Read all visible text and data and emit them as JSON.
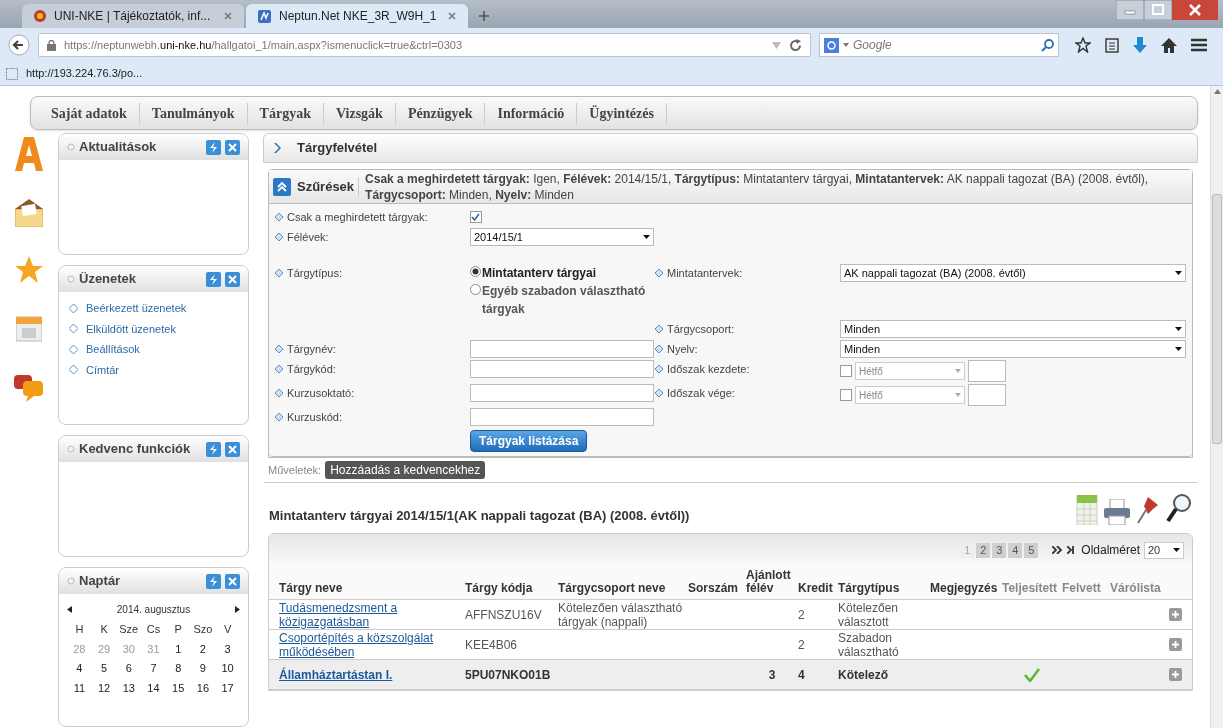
{
  "browser": {
    "tabs": [
      {
        "title": "UNI-NKE | Tájékoztatók, inf...",
        "selected": false
      },
      {
        "title": "Neptun.Net NKE_3R_W9H_1",
        "selected": true
      }
    ],
    "url": "https://neptunwebh.**uni-nke.hu**/hallgatoi_1/main.aspx?ismenuclick=true&ctrl=0303",
    "search_placeholder": "Google",
    "bookmark": "http://193.224.76.3/po..."
  },
  "menu": [
    "Saját adatok",
    "Tanulmányok",
    "Tárgyak",
    "Vizsgák",
    "Pénzügyek",
    "Információ",
    "Ügyintézés"
  ],
  "sidebar": [
    {
      "kind": "empty",
      "title": "Aktualitások"
    },
    {
      "kind": "links",
      "title": "Üzenetek",
      "links": [
        "Beérkezett üzenetek",
        "Elküldött üzenetek",
        "Beállítások",
        "Címtár"
      ]
    },
    {
      "kind": "empty",
      "title": "Kedvenc funkciók"
    },
    {
      "kind": "calendar",
      "title": "Naptár",
      "month": "2014. augusztus",
      "weekdays": [
        "H",
        "K",
        "Sze",
        "Cs",
        "P",
        "Szo",
        "V"
      ],
      "weeks": [
        [
          {
            "d": "28",
            "muted": true
          },
          {
            "d": "29",
            "muted": true
          },
          {
            "d": "30",
            "muted": true
          },
          {
            "d": "31",
            "muted": true
          },
          {
            "d": "1",
            "muted": false
          },
          {
            "d": "2",
            "muted": false
          },
          {
            "d": "3",
            "muted": false
          }
        ],
        [
          {
            "d": "4",
            "muted": false
          },
          {
            "d": "5",
            "muted": false
          },
          {
            "d": "6",
            "muted": false
          },
          {
            "d": "7",
            "muted": false
          },
          {
            "d": "8",
            "muted": false
          },
          {
            "d": "9",
            "muted": false
          },
          {
            "d": "10",
            "muted": false
          }
        ],
        [
          {
            "d": "11",
            "muted": false
          },
          {
            "d": "12",
            "muted": false
          },
          {
            "d": "13",
            "muted": false
          },
          {
            "d": "14",
            "muted": false
          },
          {
            "d": "15",
            "muted": false
          },
          {
            "d": "16",
            "muted": false
          },
          {
            "d": "17",
            "muted": false
          }
        ]
      ]
    }
  ],
  "page_title": "Tárgyfelvétel",
  "filter": {
    "label": "Szűrések",
    "summary": "**Csak a meghirdetett tárgyak:** Igen, **Félévek:** 2014/15/1, **Tárgytípus:** Mintatanterv tárgyai, **Mintatantervek:** AK nappali tagozat (BA) (2008. évtől), **Tárgycsoport:** Minden, **Nyelv:** Minden"
  },
  "form": {
    "only_announced": {
      "label": "Csak a meghirdetett tárgyak:",
      "checked": true
    },
    "semesters": {
      "label": "Félévek:",
      "value": "2014/15/1"
    },
    "type": {
      "label": "Tárgytípus:",
      "options": [
        {
          "label": "Mintatanterv tárgyai",
          "selected": true
        },
        {
          "label": "Egyéb szabadon választható tárgyak",
          "selected": false
        }
      ]
    },
    "curricula": {
      "label": "Mintatantervek:",
      "value": "AK nappali tagozat (BA) (2008. évtől)"
    },
    "group": {
      "label": "Tárgycsoport:",
      "value": "Minden"
    },
    "name": {
      "label": "Tárgynév:"
    },
    "language": {
      "label": "Nyelv:",
      "value": "Minden"
    },
    "code": {
      "label": "Tárgykód:"
    },
    "period_start": {
      "label": "Időszak kezdete:",
      "checked": false,
      "day": "Hétfő"
    },
    "teacher": {
      "label": "Kurzusoktató:"
    },
    "period_end": {
      "label": "Időszak vége:",
      "checked": false,
      "day": "Hétfő"
    },
    "course_code": {
      "label": "Kurzuskód:"
    },
    "submit": "Tárgyak listázása"
  },
  "operations": {
    "label": "Műveletek:",
    "button": "Hozzáadás a kedvencekhez"
  },
  "results": {
    "title": "Mintatanterv tárgyai 2014/15/1(AK nappali tagozat (BA) (2008. évtől))",
    "pages": [
      {
        "label": "1",
        "selected": true
      },
      {
        "label": "2",
        "selected": false
      },
      {
        "label": "3",
        "selected": false
      },
      {
        "label": "4",
        "selected": false
      },
      {
        "label": "5",
        "selected": false
      }
    ],
    "page_size_label": "Oldalméret",
    "page_size": "20",
    "columns": [
      "Tárgy neve",
      "Tárgy kódja",
      "Tárgycsoport neve",
      "Sorszám",
      "Ajánlott félév",
      "Kredit",
      "Tárgytípus",
      "Megjegyzés",
      "Teljesített",
      "Felvett",
      "Várólista"
    ],
    "rows": [
      {
        "name": "Tudásmenedzsment a közigazgatásban",
        "code": "AFFNSZU16V",
        "group": "Kötelezően választható tárgyak (nappali)",
        "semester": "",
        "credit": "2",
        "type": "Kötelezően választott",
        "completed": false,
        "bold": false
      },
      {
        "name": "Csoportépítés a közszolgálat működésében",
        "code": "KEE4B06",
        "group": "",
        "semester": "",
        "credit": "2",
        "type": "Szabadon választható",
        "completed": false,
        "bold": false
      },
      {
        "name": "Államháztartástan I.",
        "code": "5PU07NKO01B",
        "group": "",
        "semester": "3",
        "credit": "4",
        "type": "Kötelező",
        "completed": true,
        "bold": true
      }
    ]
  }
}
